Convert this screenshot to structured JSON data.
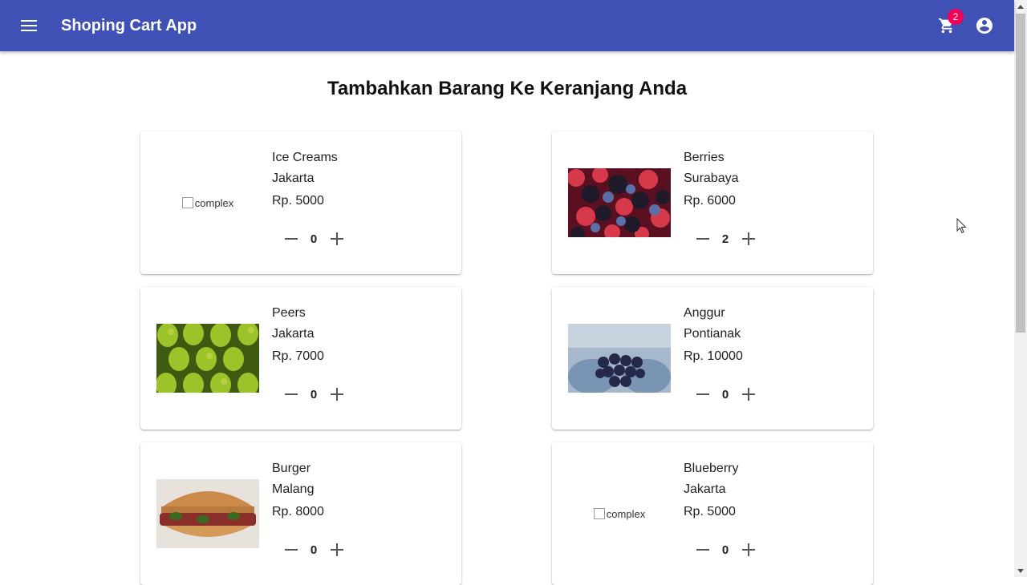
{
  "header": {
    "title": "Shoping Cart App",
    "cart_count": "2",
    "bg_color": "#3f51b5",
    "badge_color": "#f50057",
    "icons": [
      "menu-icon",
      "cart-icon",
      "account-circle-icon"
    ]
  },
  "main": {
    "heading": "Tambahkan Barang Ke Keranjang Anda",
    "products": [
      {
        "name": "Ice Creams",
        "city": "Jakarta",
        "price": "Rp. 5000",
        "qty": "0",
        "image_alt": "complex"
      },
      {
        "name": "Berries",
        "city": "Surabaya",
        "price": "Rp. 6000",
        "qty": "2"
      },
      {
        "name": "Peers",
        "city": "Jakarta",
        "price": "Rp. 7000",
        "qty": "0"
      },
      {
        "name": "Anggur",
        "city": "Pontianak",
        "price": "Rp. 10000",
        "qty": "0"
      },
      {
        "name": "Burger",
        "city": "Malang",
        "price": "Rp. 8000",
        "qty": "0"
      },
      {
        "name": "Blueberry",
        "city": "Jakarta",
        "price": "Rp. 5000",
        "qty": "0",
        "image_alt": "complex"
      }
    ]
  }
}
